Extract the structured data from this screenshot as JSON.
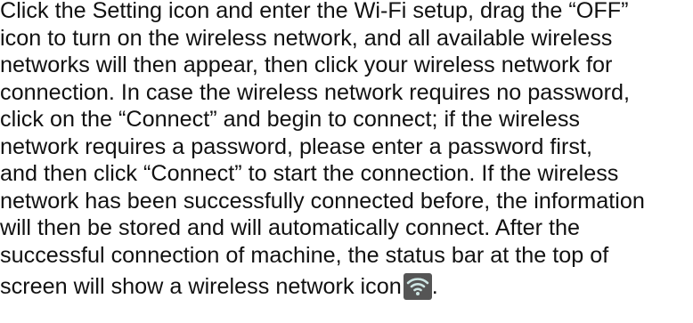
{
  "document": {
    "lines": [
      "Click the Setting icon and enter the Wi-Fi setup, drag the “OFF”",
      "icon to turn on the wireless network, and all available wireless",
      "networks will then appear, then click your wireless network for",
      "connection. In case the wireless network requires no password,",
      "click on the “Connect” and begin to connect; if the wireless",
      "network requires a password, please enter a password first,",
      "and then click “Connect” to start the connection. If the wireless",
      "network has been successfully connected before, the information",
      "will then be stored and will automatically connect. After the",
      "successful connection of machine, the status bar at the top of"
    ],
    "last_line_text": "screen will show a wireless network icon",
    "last_line_end": ".",
    "icon": "wifi-icon",
    "icon_colors": {
      "background": "#555555",
      "signal": "#cfe6e4"
    }
  }
}
